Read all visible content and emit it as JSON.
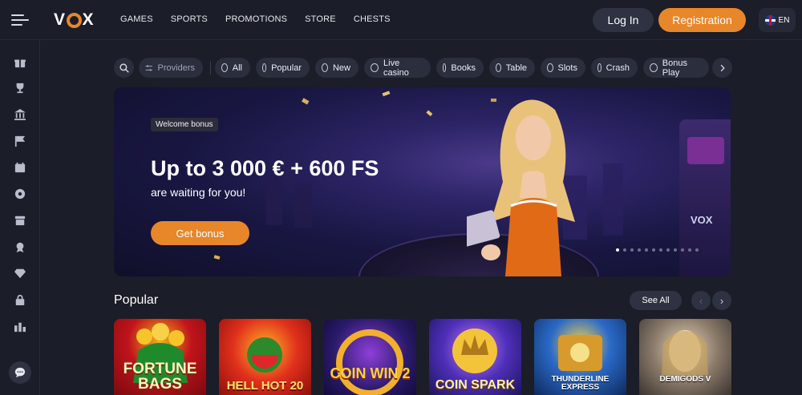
{
  "header": {
    "logo": "VOX",
    "nav": [
      "GAMES",
      "SPORTS",
      "PROMOTIONS",
      "STORE",
      "CHESTS"
    ],
    "login_label": "Log In",
    "register_label": "Registration",
    "language": "EN"
  },
  "sidebar": {
    "icons": [
      "gift-icon",
      "trophy-icon",
      "bank-icon",
      "flag-icon",
      "calendar-icon",
      "soccer-ball-icon",
      "shop-icon",
      "medal-icon",
      "diamond-icon",
      "lock-icon",
      "leaderboard-icon"
    ],
    "chat_icon": "chat-icon"
  },
  "filters": {
    "search_icon": "search-icon",
    "providers_label": "Providers",
    "categories": [
      "All",
      "Popular",
      "New",
      "Live casino",
      "Books",
      "Table",
      "Slots",
      "Crash",
      "Bonus Play"
    ]
  },
  "banner": {
    "badge": "Welcome bonus",
    "headline": "Up to 3 000 € + 600 FS",
    "subline": "are waiting for you!",
    "cta": "Get bonus",
    "machine_brand": "VOX",
    "slide_count": 12,
    "active_slide": 0
  },
  "popular": {
    "title": "Popular",
    "see_all": "See All",
    "games": [
      {
        "name": "FORTUNE BAGS",
        "bg": "#b1131c"
      },
      {
        "name": "HELL HOT 20",
        "bg": "#d9271a"
      },
      {
        "name": "COIN WIN 2",
        "bg": "#2a1a6b"
      },
      {
        "name": "COIN SPARK",
        "bg": "#3a2a8e"
      },
      {
        "name": "THUNDERLINE EXPRESS",
        "bg": "#1d4a8c"
      },
      {
        "name": "DEMIGODS V",
        "bg": "#6a5a4a"
      }
    ]
  },
  "colors": {
    "accent": "#e8862a",
    "background": "#1b1d28",
    "chip": "#2a2e3d"
  }
}
